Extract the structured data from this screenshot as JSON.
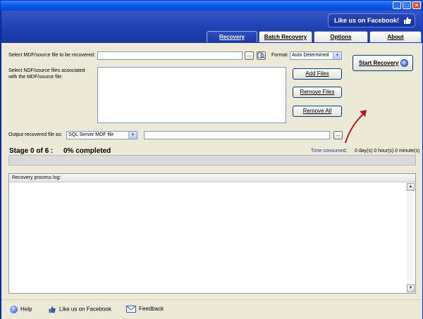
{
  "window": {
    "controls": [
      "_",
      "□",
      "×"
    ]
  },
  "banner": {
    "facebook_label": "Like us on Facebook!"
  },
  "tabs": [
    {
      "label": "Recovery",
      "active": true
    },
    {
      "label": "Batch Recovery",
      "active": false
    },
    {
      "label": "Options",
      "active": false
    },
    {
      "label": "About",
      "active": false
    }
  ],
  "form": {
    "source_label": "Select MDF/source file to be recovered:",
    "source_value": "",
    "browse_label": "...",
    "format_label": "Format:",
    "format_value": "Auto Determined",
    "ndf_label_line1": "Select NDF/source files associated",
    "ndf_label_line2": "with the MDF/source file:",
    "add_files": "Add Files",
    "remove_files": "Remove Files",
    "remove_all": "Remove All",
    "start_recovery": "Start Recovery",
    "output_label": "Output recovered file as:",
    "output_type": "SQL Server MDF file",
    "output_path": "",
    "output_browse": "..."
  },
  "status": {
    "stage": "Stage 0 of 6 :",
    "completed": "0% completed",
    "progress_percent": 0,
    "time_label": "Time consumed:",
    "time_value": "0 day(s) 0 hour(s) 0 minute(s)"
  },
  "log": {
    "header": "Recovery process log:"
  },
  "footer": {
    "help": "Help",
    "facebook": "Like us on Facebook",
    "feedback": "Feedback"
  },
  "colors": {
    "accent_blue": "#1d3fb0",
    "annotation_red": "#c0181c",
    "panel": "#ece9d8"
  },
  "icons": [
    "minimize-icon",
    "maximize-icon",
    "close-icon",
    "thumbs-up-icon",
    "scan-icon",
    "go-arrow-icon",
    "help-icon",
    "envelope-icon"
  ]
}
